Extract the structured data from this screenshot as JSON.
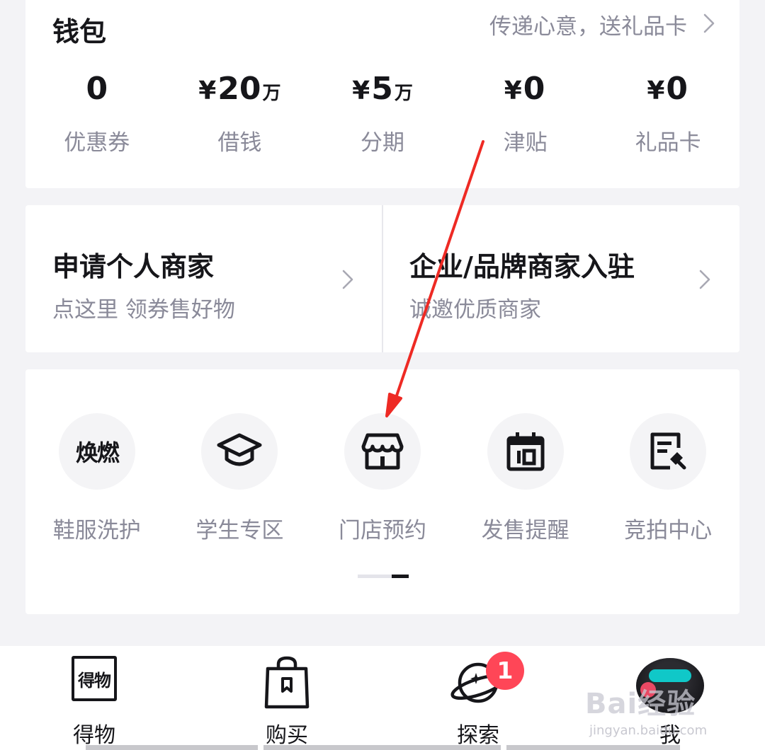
{
  "wallet": {
    "title": "钱包",
    "gift_link": "传递心意，送礼品卡",
    "stats": [
      {
        "prefix": "",
        "value": "0",
        "unit": "",
        "label": "优惠券"
      },
      {
        "prefix": "¥",
        "value": "20",
        "unit": "万",
        "label": "借钱"
      },
      {
        "prefix": "¥",
        "value": "5",
        "unit": "万",
        "label": "分期"
      },
      {
        "prefix": "¥",
        "value": "0",
        "unit": "",
        "label": "津贴"
      },
      {
        "prefix": "¥",
        "value": "0",
        "unit": "",
        "label": "礼品卡"
      }
    ]
  },
  "merchant": {
    "personal": {
      "title": "申请个人商家",
      "subtitle": "点这里 领券售好物"
    },
    "enterprise": {
      "title": "企业/品牌商家入驻",
      "subtitle": "诚邀优质商家"
    }
  },
  "services": {
    "items": [
      {
        "label": "鞋服洗护",
        "icon_text": "焕燃",
        "icon": "huanzhuang-logo-icon"
      },
      {
        "label": "学生专区",
        "icon": "graduation-cap-icon"
      },
      {
        "label": "门店预约",
        "icon": "storefront-icon"
      },
      {
        "label": "发售提醒",
        "icon": "calendar-icon"
      },
      {
        "label": "竞拍中心",
        "icon": "auction-document-icon"
      }
    ],
    "pager": {
      "pages": 2,
      "active": 2
    }
  },
  "tabbar": {
    "tabs": [
      {
        "label": "得物",
        "icon_text": "得物",
        "icon": "dewu-logo-icon"
      },
      {
        "label": "购买",
        "icon": "shopping-bag-icon"
      },
      {
        "label": "探索",
        "icon": "planet-icon",
        "badge": "1"
      },
      {
        "label": "我",
        "icon": "avatar-icon"
      }
    ]
  },
  "annotation": {
    "color": "#ee2a24"
  },
  "watermark": {
    "logo": "Bai经验",
    "url": "jingyan.baidu.com"
  },
  "colors": {
    "primary_text": "#16161a",
    "secondary_text": "#8a8a99",
    "badge": "#ff4657",
    "background": "#f3f3f6"
  }
}
